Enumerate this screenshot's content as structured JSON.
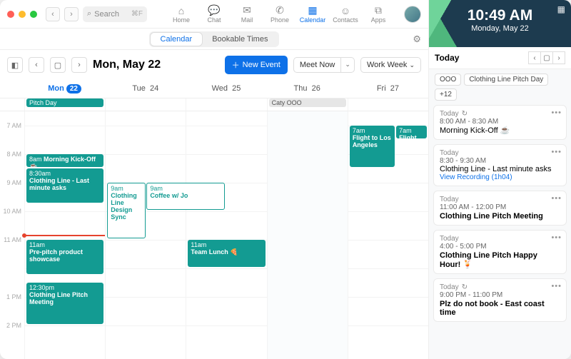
{
  "search": {
    "placeholder": "Search",
    "kbd": "⌘F"
  },
  "appnav": {
    "home": "Home",
    "chat": "Chat",
    "mail": "Mail",
    "phone": "Phone",
    "calendar": "Calendar",
    "contacts": "Contacts",
    "apps": "Apps"
  },
  "tabs": {
    "calendar": "Calendar",
    "bookable": "Bookable Times"
  },
  "header": {
    "title": "Mon, May 22",
    "new_event": "New Event",
    "meet_now": "Meet Now",
    "view": "Work Week"
  },
  "days": {
    "mon": {
      "label": "Mon",
      "num": "22"
    },
    "tue": {
      "label": "Tue",
      "num": "24"
    },
    "wed": {
      "label": "Wed",
      "num": "25"
    },
    "thu": {
      "label": "Thu",
      "num": "26"
    },
    "fri": {
      "label": "Fri",
      "num": "27"
    }
  },
  "allday": {
    "mon": "Pitch Day",
    "thu": "Caty OOO"
  },
  "hours": {
    "h7": "7 AM",
    "h8": "8 AM",
    "h9": "9 AM",
    "h10": "10 AM",
    "h11": "11 AM",
    "h12": "",
    "h13": "1 PM",
    "h14": "2 PM"
  },
  "events": {
    "mon_kickoff": {
      "time": "8am",
      "title": "Morning Kick-Off ☕"
    },
    "mon_asks": {
      "time": "8:30am",
      "title": "Clothing Line - Last minute asks"
    },
    "mon_showcase": {
      "time": "11am",
      "title": "Pre-pitch product showcase"
    },
    "mon_pitch": {
      "time": "12:30pm",
      "title": "Clothing Line Pitch Meeting"
    },
    "tue_design": {
      "time": "9am",
      "title": "Clothing Line Design Sync"
    },
    "wed_coffee": {
      "time": "9am",
      "title": "Coffee w/ Jo"
    },
    "wed_lunch": {
      "time": "11am",
      "title": "Team Lunch 🍕"
    },
    "fri_flight1": {
      "time": "7am",
      "title": "Flight to Los Angeles"
    },
    "fri_flight2": {
      "time": "7am",
      "title": "Flight to"
    }
  },
  "clock": {
    "time": "10:49 AM",
    "date": "Monday, May 22"
  },
  "agenda": {
    "label": "Today",
    "filters": {
      "ooo": "OOO",
      "pitch": "Clothing Line Pitch Day",
      "more": "+12"
    },
    "items": [
      {
        "label": "Today",
        "repeat": true,
        "time": "8:00 AM - 8:30 AM",
        "title": "Morning Kick-Off ☕"
      },
      {
        "label": "Today",
        "time": "8:30 - 9:30 AM",
        "title": "Clothing Line - Last minute asks",
        "link": "View Recording  (1h04)"
      },
      {
        "label": "Today",
        "time": "11:00 AM - 12:00 PM",
        "title": "Clothing Line Pitch Meeting"
      },
      {
        "label": "Today",
        "time": "4:00 - 5:00 PM",
        "title": "Clothing Line Pitch Happy Hour! 🍹"
      },
      {
        "label": "Today",
        "repeat": true,
        "time": "9:00 PM - 11:00 PM",
        "title": "Plz do not book - East coast time"
      }
    ]
  }
}
